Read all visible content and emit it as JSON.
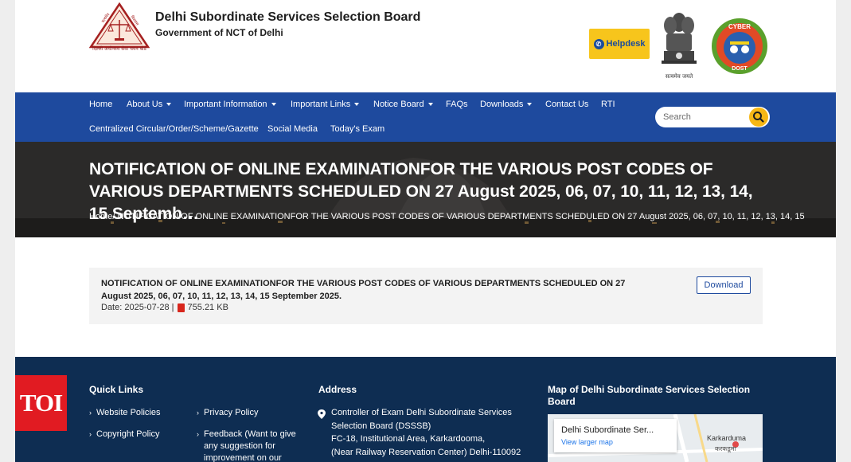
{
  "header": {
    "logo_caption": "दिल्ली अधीनस्थ सेवा चयन बोर्ड",
    "org_name": "Delhi Subordinate Services Selection Board",
    "org_sub": "Government of NCT of Delhi",
    "helpdesk_label": "Helpdesk",
    "emblem_motto": "सत्यमेव जयते",
    "cyber_badge_top": "CYBER",
    "cyber_badge_bottom": "DOST"
  },
  "nav": {
    "row1": [
      {
        "label": "Home",
        "dropdown": false
      },
      {
        "label": "About Us",
        "dropdown": true
      },
      {
        "label": "Important Information",
        "dropdown": true
      },
      {
        "label": "Important Links",
        "dropdown": true
      },
      {
        "label": "Notice Board",
        "dropdown": true
      },
      {
        "label": "FAQs",
        "dropdown": false
      },
      {
        "label": "Downloads",
        "dropdown": true
      },
      {
        "label": "Contact Us",
        "dropdown": false
      },
      {
        "label": "RTI",
        "dropdown": false
      }
    ],
    "row2": [
      {
        "label": "Centralized Circular/Order/Scheme/Gazette"
      },
      {
        "label": "Social Media"
      },
      {
        "label": "Today's Exam"
      }
    ],
    "search_placeholder": "Search"
  },
  "hero": {
    "title": "NOTIFICATION OF ONLINE EXAMINATIONFOR THE VARIOUS POST CODES OF VARIOUS DEPARTMENTS SCHEDULED ON 27 August 2025, 06, 07, 10, 11, 12, 13, 14, 15 Septemb…",
    "breadcrumb_home": "Home/",
    "breadcrumb_current": " NOTIFICATION OF ONLINE EXAMINATIONFOR THE VARIOUS POST CODES OF VARIOUS DEPARTMENTS SCHEDULED ON 27 August 2025, 06, 07, 10, 11, 12, 13, 14, 15"
  },
  "notice": {
    "title": "NOTIFICATION OF ONLINE EXAMINATIONFOR THE VARIOUS POST CODES OF VARIOUS DEPARTMENTS SCHEDULED ON 27 August 2025, 06, 07, 10, 11, 12, 13, 14, 15 September 2025.",
    "date_label": "Date: 2025-07-28 |",
    "file_size": "755.21 KB",
    "download_label": "Download"
  },
  "footer": {
    "quick_links_title": "Quick Links",
    "links_col1": [
      "Website Policies",
      "Copyright Policy"
    ],
    "links_col2": [
      "Privacy Policy",
      "Feedback (Want to give any suggestion for improvement on our"
    ],
    "address_title": "Address",
    "address_lines": [
      "Controller of Exam Delhi Subordinate Services",
      "Selection Board (DSSSB)",
      "FC-18, Institutional Area, Karkardooma,",
      "(Near Railway Reservation Center) Delhi-110092"
    ],
    "map_title": "Map of Delhi Subordinate Services Selection Board",
    "map_place_name": "Delhi Subordinate Ser...",
    "map_view_larger": "View larger map",
    "map_label_karkarduma": "Karkarduma",
    "map_label_karkarduma_hi": "करकडूमा"
  },
  "watermark": {
    "text": "TOI"
  },
  "colors": {
    "nav_bg": "#1e4a9e",
    "footer_bg": "#0e2d52",
    "search_button": "#f6b716",
    "helpdesk_bg": "#f7c51c",
    "pdf_icon": "#d8261c",
    "toi_red": "#e11b22"
  }
}
